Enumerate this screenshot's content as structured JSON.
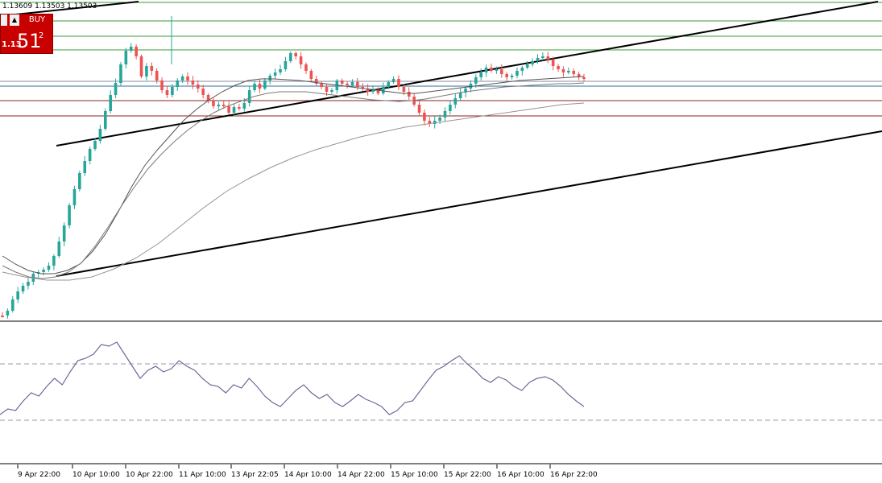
{
  "ohlc_text": "1.13609 1.13503 1.13503",
  "trade_panel": {
    "buy_label": "BUY",
    "price_prefix": "1.13",
    "price_main": "51",
    "price_super": "2",
    "arrow_icon": "dropdown-arrow-icon"
  },
  "colors": {
    "candle_up": "#26a69a",
    "candle_down": "#ef5350",
    "green_level": "#3c9a3c",
    "red_level": "#8b2020",
    "blue_level": "#2f6f9f",
    "rsi_line": "#6a6a9a",
    "buy_panel": "#c80000"
  },
  "chart_data": {
    "type": "candlestick",
    "x_axis_labels": [
      "9 Apr 22:00",
      "10 Apr 10:00",
      "10 Apr 22:00",
      "11 Apr 10:00",
      "13 Apr 22:05",
      "14 Apr 10:00",
      "14 Apr 22:00",
      "15 Apr 10:00",
      "15 Apr 22:00",
      "16 Apr 10:00",
      "16 Apr 22:00"
    ],
    "price_series": [
      392,
      386,
      372,
      362,
      355,
      350,
      340,
      338,
      335,
      330,
      318,
      300,
      280,
      255,
      235,
      215,
      200,
      185,
      175,
      160,
      138,
      118,
      103,
      80,
      63,
      58,
      70,
      95,
      82,
      88,
      100,
      112,
      118,
      108,
      100,
      95,
      100,
      105,
      110,
      118,
      125,
      132,
      130,
      132,
      140,
      133,
      135,
      128,
      112,
      104,
      110,
      100,
      94,
      90,
      86,
      76,
      66,
      70,
      80,
      88,
      98,
      104,
      108,
      114,
      112,
      100,
      104,
      106,
      102,
      108,
      110,
      114,
      112,
      116,
      108,
      102,
      98,
      108,
      114,
      120,
      130,
      140,
      150,
      154,
      150,
      146,
      138,
      130,
      122,
      115,
      110,
      104,
      96,
      90,
      84,
      88,
      86,
      92,
      96,
      94,
      88,
      84,
      80,
      76,
      72,
      70,
      74,
      82,
      86,
      90,
      88,
      92,
      96,
      98
    ],
    "moving_averages": [
      {
        "values": [
          318,
          328,
          336,
          340,
          340,
          336,
          328,
          312,
          290,
          262,
          232,
          206,
          186,
          168,
          150,
          136,
          124,
          114,
          106,
          100,
          98,
          98,
          99,
          100,
          102,
          104,
          106,
          108,
          110,
          112,
          114,
          116,
          116,
          114,
          112,
          110,
          108,
          106,
          104,
          102,
          100,
          99,
          98,
          97,
          96,
          95
        ]
      },
      {
        "values": [
          330,
          338,
          344,
          346,
          344,
          338,
          326,
          306,
          282,
          256,
          232,
          210,
          192,
          176,
          162,
          150,
          140,
          132,
          126,
          120,
          116,
          114,
          114,
          114,
          116,
          118,
          120,
          122,
          124,
          125,
          126,
          125,
          123,
          120,
          117,
          114,
          112,
          110,
          108,
          107,
          106,
          105,
          104,
          104,
          103
        ]
      },
      {
        "values": [
          338,
          344,
          348,
          348,
          344,
          334,
          320,
          302,
          280,
          258,
          238,
          222,
          208,
          196,
          186,
          178,
          170,
          164,
          158,
          154,
          150,
          146,
          142,
          138,
          134,
          130,
          128
        ]
      }
    ],
    "levels": [
      {
        "color_key": "green_level",
        "y_pos": "near-top"
      },
      {
        "color_key": "green_level",
        "y_pos": "upper"
      },
      {
        "color_key": "green_level",
        "y_pos": "upper-mid"
      },
      {
        "color_key": "blue_level",
        "y_pos": "mid"
      },
      {
        "color_key": "red_level",
        "y_pos": "lower-mid"
      },
      {
        "color_key": "red_level",
        "y_pos": "lower"
      }
    ],
    "trendlines": "ascending channel",
    "rsi_series": [
      515,
      508,
      510,
      498,
      488,
      492,
      480,
      470,
      478,
      462,
      448,
      445,
      440,
      428,
      430,
      425,
      440,
      455,
      470,
      460,
      455,
      462,
      458,
      448,
      455,
      460,
      470,
      478,
      480,
      488,
      478,
      482,
      470,
      480,
      492,
      500,
      505,
      495,
      485,
      478,
      488,
      495,
      490,
      500,
      505,
      498,
      490,
      496,
      500,
      505,
      515,
      510,
      500,
      498,
      485,
      472,
      460,
      455,
      448,
      442,
      452,
      460,
      470,
      475,
      468,
      472,
      480,
      485,
      475,
      470,
      468,
      472,
      480,
      490,
      498,
      505
    ]
  }
}
